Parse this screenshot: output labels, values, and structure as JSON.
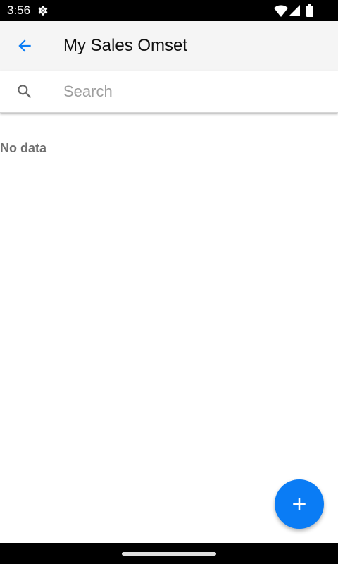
{
  "status_bar": {
    "time": "3:56",
    "icons": [
      "settings-icon",
      "wifi-icon",
      "signal-icon",
      "battery-icon"
    ]
  },
  "app_bar": {
    "back_icon": "arrow-back-icon",
    "title": "My Sales Omset"
  },
  "search": {
    "icon": "search-icon",
    "placeholder": "Search",
    "value": ""
  },
  "content": {
    "empty_message": "No data"
  },
  "fab": {
    "icon": "plus-icon"
  },
  "colors": {
    "accent": "#0a7cf5",
    "app_bar_background": "#f5f5f5",
    "status_bar_background": "#000000"
  }
}
